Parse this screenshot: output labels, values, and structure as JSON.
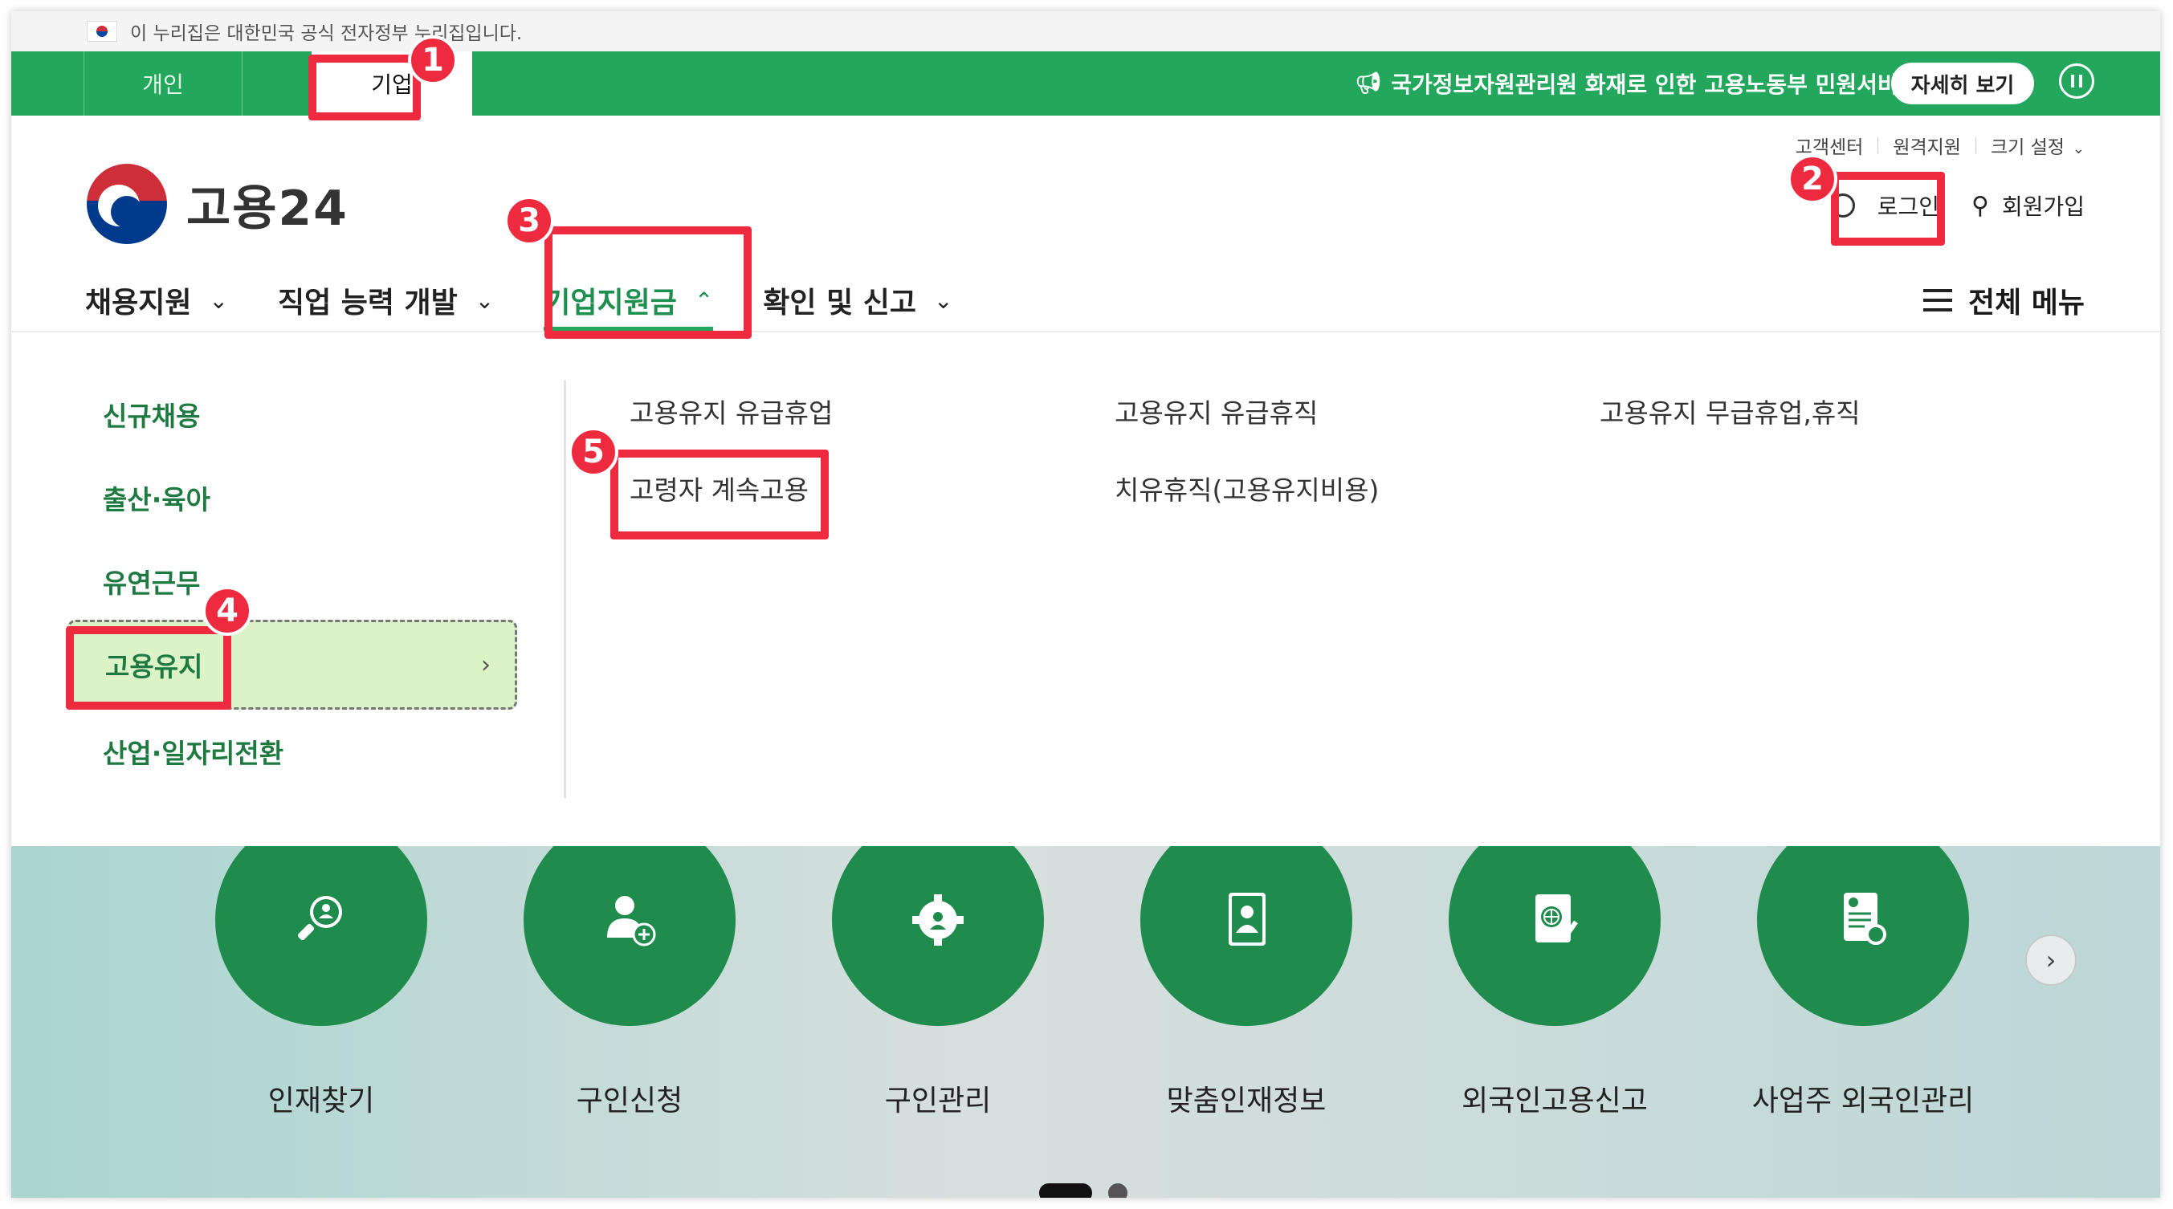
{
  "notice": {
    "text": "이 누리집은 대한민국 공식 전자정부 누리집입니다."
  },
  "topbar": {
    "tabs": [
      "개인",
      "기업"
    ],
    "announcement": "국가정보자원관리원 화재로 인한 고용노동부 민원서비스 이용 안내",
    "more_button": "자세히 보기"
  },
  "header": {
    "util_links": [
      "고객센터",
      "원격지원",
      "크기 설정"
    ],
    "logo_text": "고용24",
    "login": "로그인",
    "signup": "회원가입"
  },
  "nav": {
    "items": [
      "채용지원",
      "직업 능력 개발",
      "기업지원금",
      "확인 및 신고"
    ],
    "active": "기업지원금",
    "all_menu": "전체 메뉴"
  },
  "submenu": {
    "items": [
      "신규채용",
      "출산·육아",
      "유연근무",
      "고용유지",
      "산업·일자리전환"
    ],
    "active": "고용유지"
  },
  "links": [
    "고용유지 유급휴업",
    "고용유지 유급휴직",
    "고용유지 무급휴업,휴직",
    "고령자 계속고용",
    "치유휴직(고용유지비용)"
  ],
  "services": [
    "인재찾기",
    "구인신청",
    "구인관리",
    "맞춤인재정보",
    "외국인고용신고",
    "사업주 외국인관리"
  ],
  "annotations": [
    "1",
    "2",
    "3",
    "4",
    "5"
  ],
  "colors": {
    "brand_green": "#23a75d",
    "highlight_red": "#ee2a3f",
    "service_green": "#1f8c4e"
  }
}
